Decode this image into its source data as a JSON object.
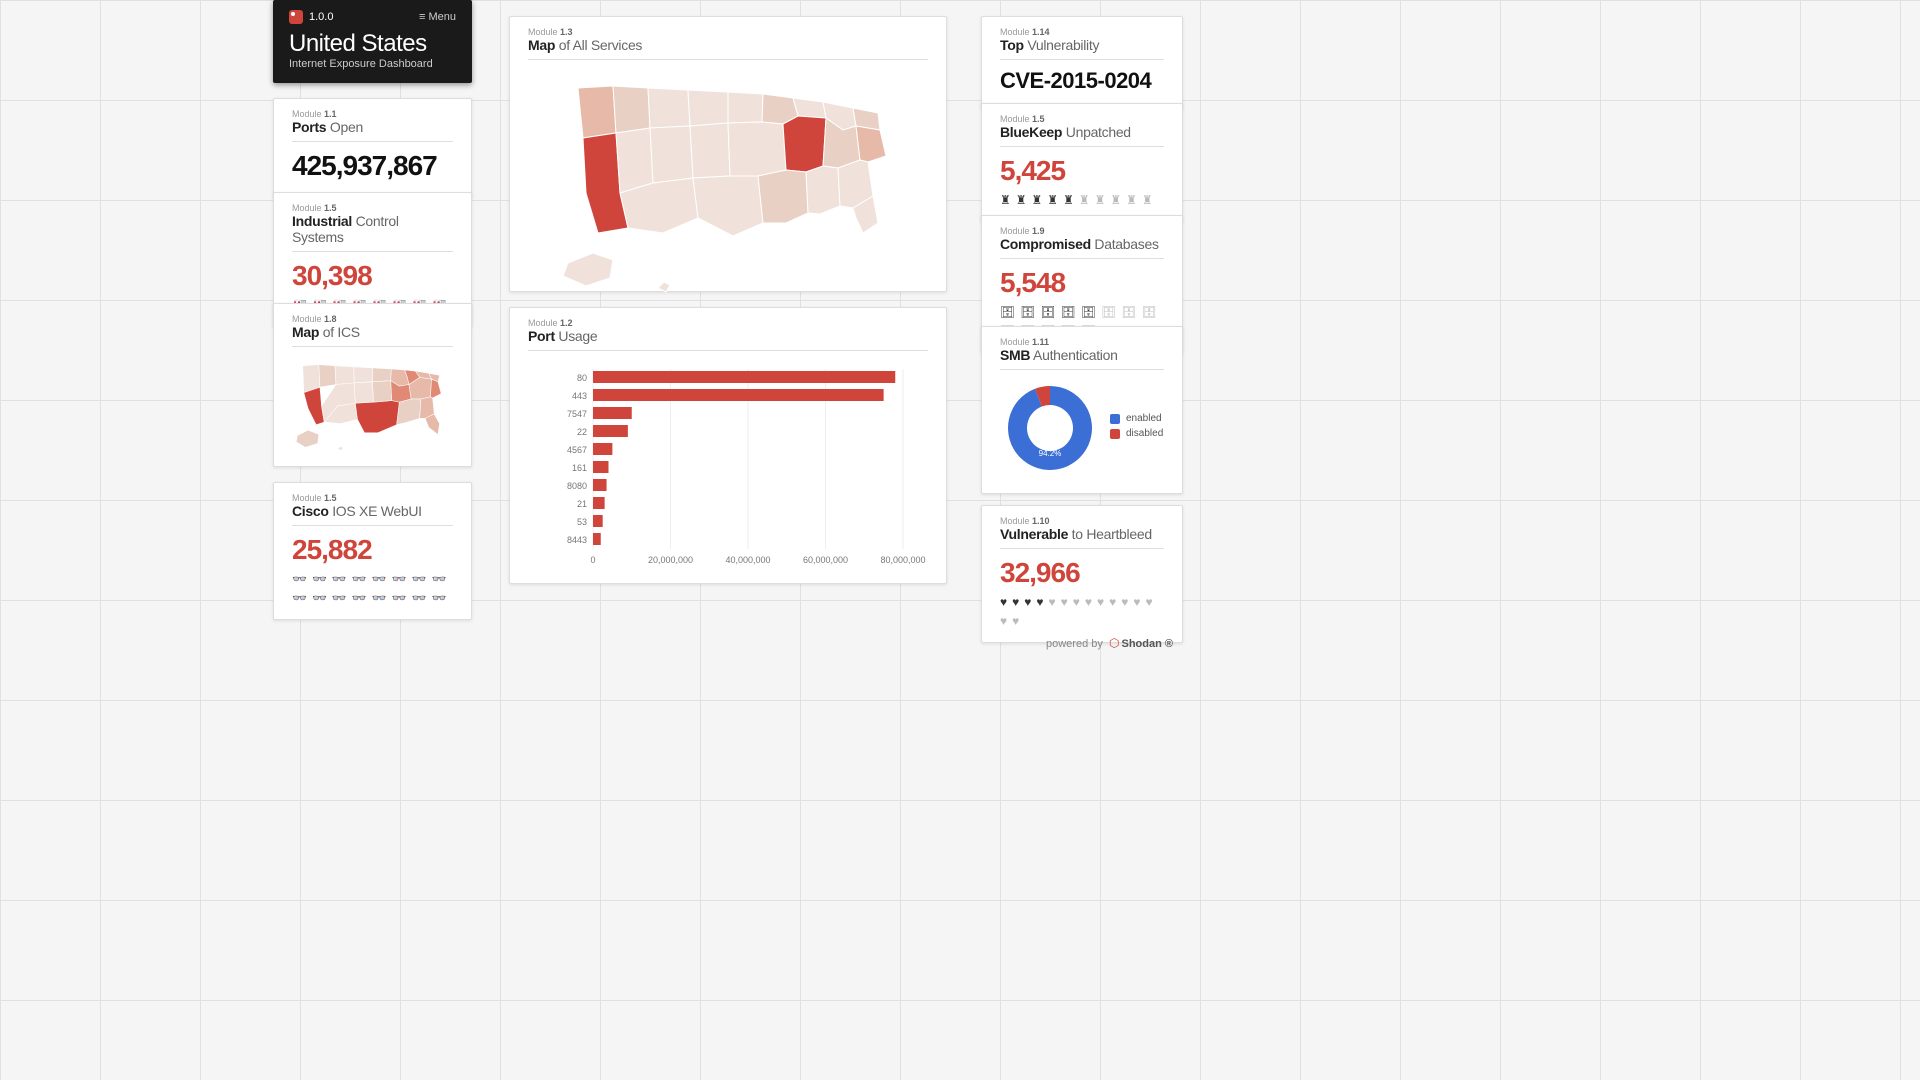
{
  "version": "1.0.0",
  "menu_label": "Menu",
  "header": {
    "title": "United States",
    "subtitle": "Internet Exposure Dashboard"
  },
  "ports_open": {
    "module": "1.1",
    "title_bold": "Ports",
    "title_rest": "Open",
    "value": "425,937,867"
  },
  "ics": {
    "module": "1.5",
    "title_bold": "Industrial",
    "title_rest": "Control Systems",
    "value": "30,398",
    "icons_filled": 3,
    "icons_total": 8,
    "glyph": "🏭"
  },
  "map_ics": {
    "module": "1.8",
    "title_bold": "Map",
    "title_rest": "of ICS"
  },
  "cisco": {
    "module": "1.5",
    "title_bold": "Cisco",
    "title_rest": "IOS XE WebUI",
    "value": "25,882",
    "icons_filled": 1,
    "icons_total": 16,
    "glyph": "👓"
  },
  "map_all": {
    "module": "1.3",
    "title_bold": "Map",
    "title_rest": "of All Services"
  },
  "port_usage": {
    "module": "1.2",
    "title_bold": "Port",
    "title_rest": "Usage"
  },
  "top_vuln": {
    "module": "1.14",
    "title_bold": "Top",
    "title_rest": "Vulnerability",
    "value": "CVE-2015-0204"
  },
  "bluekeep": {
    "module": "1.5",
    "title_bold": "BlueKeep",
    "title_rest": "Unpatched",
    "value": "5,425",
    "icons_filled": 5,
    "icons_total": 10,
    "glyph": "♜"
  },
  "compromised": {
    "module": "1.9",
    "title_bold": "Compromised",
    "title_rest": "Databases",
    "value": "5,548",
    "icons_filled": 5,
    "icons_total": 13,
    "glyph": "🗄"
  },
  "smb": {
    "module": "1.11",
    "title_bold": "SMB",
    "title_rest": "Authentication",
    "legend": [
      "enabled",
      "disabled"
    ],
    "colors": [
      "#3b6fd6",
      "#d0453b"
    ],
    "percent_label": "94.2%"
  },
  "heartbleed": {
    "module": "1.10",
    "title_bold": "Vulnerable",
    "title_rest": "to Heartbleed",
    "value": "32,966",
    "icons_filled": 4,
    "icons_total": 15,
    "glyph": "♥"
  },
  "footer": {
    "powered": "powered by",
    "brand": "Shodan ®"
  },
  "chart_data": [
    {
      "type": "bar",
      "title": "Port Usage",
      "orientation": "horizontal",
      "xlabel": "",
      "ylabel": "",
      "xlim": [
        0,
        80000000
      ],
      "xticks": [
        0,
        20000000,
        40000000,
        60000000,
        80000000
      ],
      "xtick_labels": [
        "0",
        "20,000,000",
        "40,000,000",
        "60,000,000",
        "80,000,000"
      ],
      "categories": [
        "80",
        "443",
        "7547",
        "22",
        "4567",
        "161",
        "8080",
        "21",
        "53",
        "8443"
      ],
      "values": [
        78000000,
        75000000,
        10000000,
        9000000,
        5000000,
        4000000,
        3500000,
        3000000,
        2500000,
        2000000
      ],
      "color": "#d0453b"
    },
    {
      "type": "pie",
      "title": "SMB Authentication",
      "hole": 0.55,
      "series": [
        {
          "name": "enabled",
          "value": 94.2,
          "color": "#3b6fd6"
        },
        {
          "name": "disabled",
          "value": 5.8,
          "color": "#d0453b"
        }
      ],
      "center_label": "94.2%"
    }
  ]
}
